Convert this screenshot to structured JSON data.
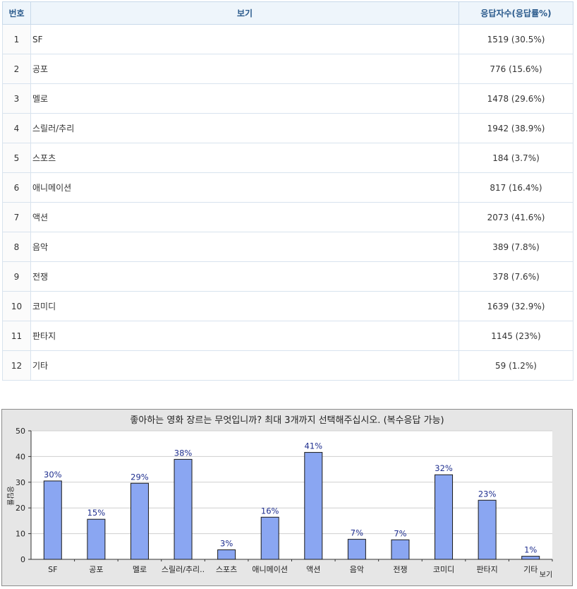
{
  "table": {
    "headers": {
      "no": "번호",
      "label": "보기",
      "count": "응답자수(응답률%)"
    },
    "rows": [
      {
        "no": "1",
        "label": "SF",
        "count": "1519 (30.5%)"
      },
      {
        "no": "2",
        "label": "공포",
        "count": "776 (15.6%)"
      },
      {
        "no": "3",
        "label": "멜로",
        "count": "1478 (29.6%)"
      },
      {
        "no": "4",
        "label": "스릴러/추리",
        "count": "1942 (38.9%)"
      },
      {
        "no": "5",
        "label": "스포츠",
        "count": "184 (3.7%)"
      },
      {
        "no": "6",
        "label": "애니메이션",
        "count": "817 (16.4%)"
      },
      {
        "no": "7",
        "label": "액션",
        "count": "2073 (41.6%)"
      },
      {
        "no": "8",
        "label": "음악",
        "count": "389 (7.8%)"
      },
      {
        "no": "9",
        "label": "전쟁",
        "count": "378 (7.6%)"
      },
      {
        "no": "10",
        "label": "코미디",
        "count": "1639 (32.9%)"
      },
      {
        "no": "11",
        "label": "판타지",
        "count": "1145 (23%)"
      },
      {
        "no": "12",
        "label": "기타",
        "count": "59 (1.2%)"
      }
    ]
  },
  "chart_data": {
    "type": "bar",
    "title": "좋아하는 영화 장르는 무엇입니까? 최대 3개까지 선택해주십시오. (복수응답 가능)",
    "xlabel": "보기",
    "ylabel": "응답률",
    "ylim": [
      0,
      50
    ],
    "yticks": [
      0,
      10,
      20,
      30,
      40,
      50
    ],
    "categories": [
      "SF",
      "공포",
      "멜로",
      "스릴러/추리..",
      "스포츠",
      "애니메이션",
      "액션",
      "음악",
      "전쟁",
      "코미디",
      "판타지",
      "기타"
    ],
    "values": [
      30.5,
      15.6,
      29.6,
      38.9,
      3.7,
      16.4,
      41.6,
      7.8,
      7.6,
      32.9,
      23,
      1.2
    ],
    "data_labels": [
      "30%",
      "15%",
      "29%",
      "38%",
      "3%",
      "16%",
      "41%",
      "7%",
      "7%",
      "32%",
      "23%",
      "1%"
    ],
    "grid": true,
    "bar_color": "#8aa6f2",
    "bar_border_color": "#1a1a1a",
    "label_color": "#1f2f8f",
    "background_color": "#e6e6e6"
  }
}
